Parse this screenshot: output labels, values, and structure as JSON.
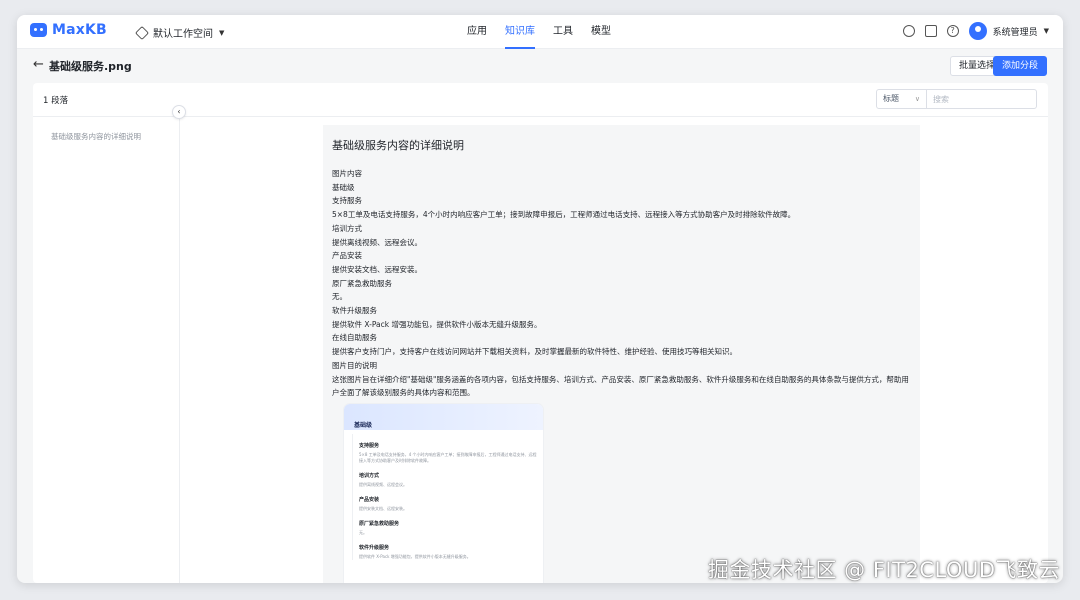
{
  "app": {
    "name": "MaxKB",
    "workspace": "默认工作空间"
  },
  "nav": [
    {
      "label": "应用",
      "active": false
    },
    {
      "label": "知识库",
      "active": true
    },
    {
      "label": "工具",
      "active": false
    },
    {
      "label": "模型",
      "active": false
    }
  ],
  "user": {
    "name": "系统管理员"
  },
  "header": {
    "title": "基础级服务.png",
    "batch_select": "批量选择",
    "add_segment": "添加分段"
  },
  "toolbar": {
    "segment_count": "1 段落",
    "filter_type": "标题",
    "search_placeholder": "搜索"
  },
  "sidebar": {
    "items": [
      "基础级服务内容的详细说明"
    ]
  },
  "document": {
    "title": "基础级服务内容的详细说明",
    "lines": [
      "图片内容",
      "基础级",
      "支持服务",
      "5×8工单及电话支持服务，4个小时内响应客户工单；接到故障申报后，工程师通过电话支持、远程接入等方式协助客户及时排除软件故障。",
      "培训方式",
      "提供离线视频、远程会议。",
      "产品安装",
      "提供安装文档、远程安装。",
      "原厂紧急救助服务",
      "无。",
      "软件升级服务",
      "提供软件 X-Pack 增强功能包，提供软件小版本无缝升级服务。",
      "在线自助服务",
      "提供客户支持门户，支持客户在线访问网站并下载相关资料，及时掌握最新的软件特性、维护经验、使用技巧等相关知识。",
      "图片目的说明",
      "这张图片旨在详细介绍\"基础级\"服务涵盖的各项内容，包括支持服务、培训方式、产品安装、原厂紧急救助服务、软件升级服务和在线自助服务的具体条款与提供方式，帮助用户全面了解该级别服务的具体内容和范围。"
    ],
    "embedded_image": {
      "title": "基础级",
      "sections": [
        {
          "heading": "支持服务",
          "text": "5×8 工单及电话支持服务，4 个小时内响应客户工单；接到故障申报后，工程师通过电话支持、远程接入等方式协助客户及时排除软件故障。"
        },
        {
          "heading": "培训方式",
          "text": "提供离线视频、远程会议。"
        },
        {
          "heading": "产品安装",
          "text": "提供安装文档、远程安装。"
        },
        {
          "heading": "原厂紧急救助服务",
          "text": "无。"
        },
        {
          "heading": "软件升级服务",
          "text": "提供软件 X-Pack 增强功能包，提供软件小版本无缝升级服务。"
        }
      ]
    }
  },
  "watermark": "掘金技术社区 @ FIT2CLOUD飞致云"
}
